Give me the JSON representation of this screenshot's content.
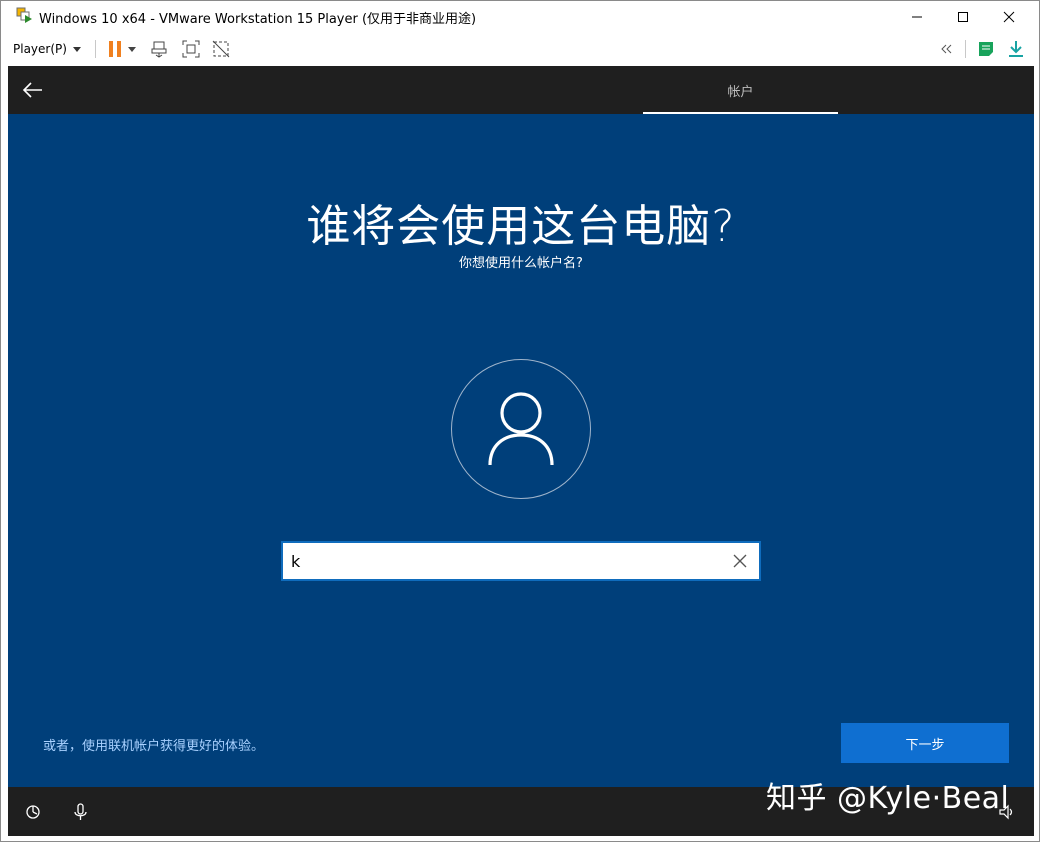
{
  "window": {
    "title": "Windows 10 x64 - VMware Workstation 15 Player (仅用于非商业用途)",
    "app_icon": "vmware-player-icon"
  },
  "window_controls": {
    "minimize_icon": "minimize-icon",
    "maximize_icon": "maximize-icon",
    "close_icon": "close-icon"
  },
  "toolbar": {
    "player_menu_label": "Player(P)",
    "icons": [
      "pause-icon",
      "dropdown-caret-icon",
      "send-ctrl-alt-del-icon",
      "fullscreen-icon",
      "unity-icon",
      "collapse-icon",
      "notes-icon",
      "download-icon"
    ]
  },
  "oobe": {
    "back_icon": "back-arrow-icon",
    "tab_label": "帐户",
    "title": "谁将会使用这台电脑?",
    "subtitle": "你想使用什么帐户名?",
    "avatar_icon": "user-icon",
    "name_input_value": "k",
    "clear_icon": "clear-x-icon",
    "online_account_link": "或者，使用联机帐户获得更好的体验。",
    "next_button_label": "下一步",
    "bottom_icons": [
      "ease-of-access-icon",
      "microphone-icon",
      "volume-icon"
    ]
  },
  "watermark": "知乎 @Kyle·Beal",
  "colors": {
    "vm_background": "#003f7a",
    "oobe_bar": "#1f1f1f",
    "next_button": "#0f6fd1",
    "pause_orange": "#f0801f",
    "link_color": "#a9d1ff"
  }
}
